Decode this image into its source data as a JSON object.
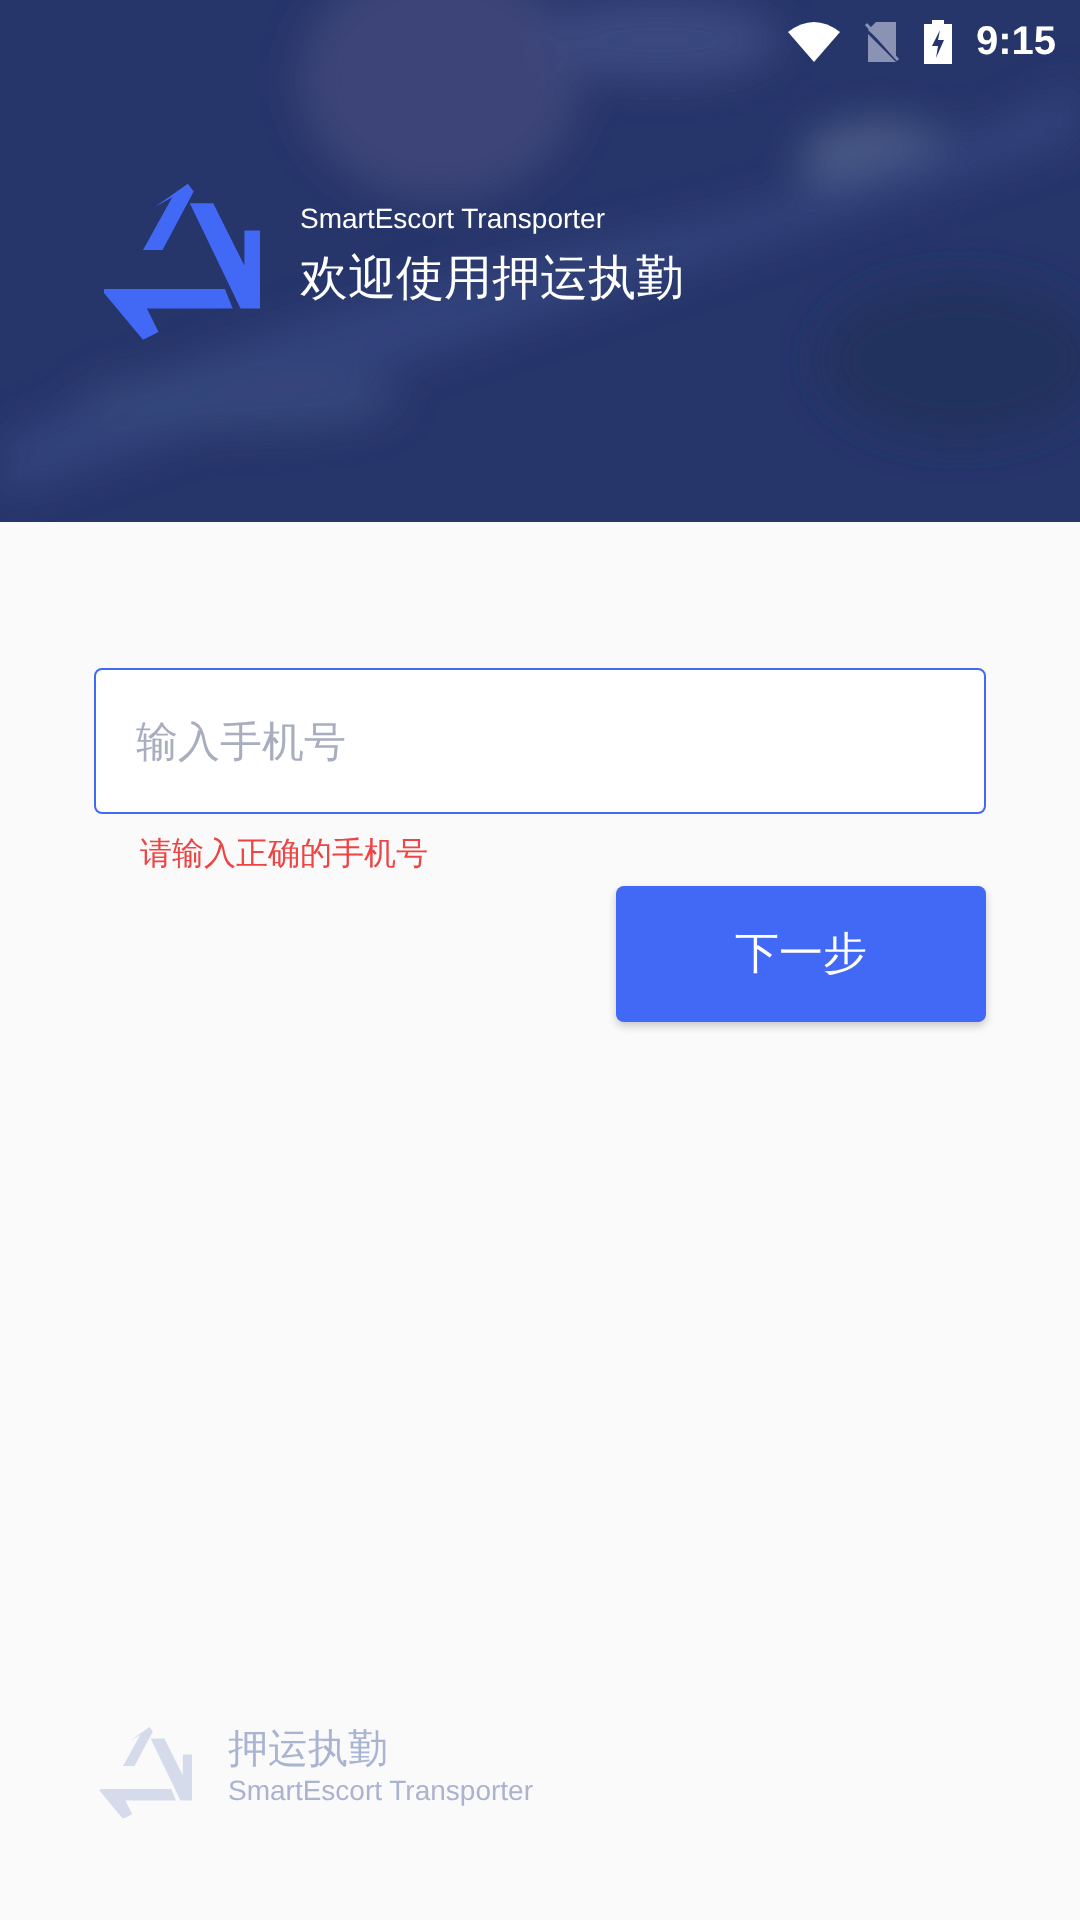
{
  "status_bar": {
    "time": "9:15"
  },
  "header": {
    "kind": "picture",
    "subtitle": "SmartEscort Transporter",
    "title": "欢迎使用押运执勤"
  },
  "phone_field": {
    "placeholder": "输入手机号",
    "focused": true
  },
  "error": "请输入正确的手机号",
  "next_button": "下一步",
  "footer": {
    "title": "押运执勤",
    "subtitle": "SmartEscort Transporter"
  }
}
